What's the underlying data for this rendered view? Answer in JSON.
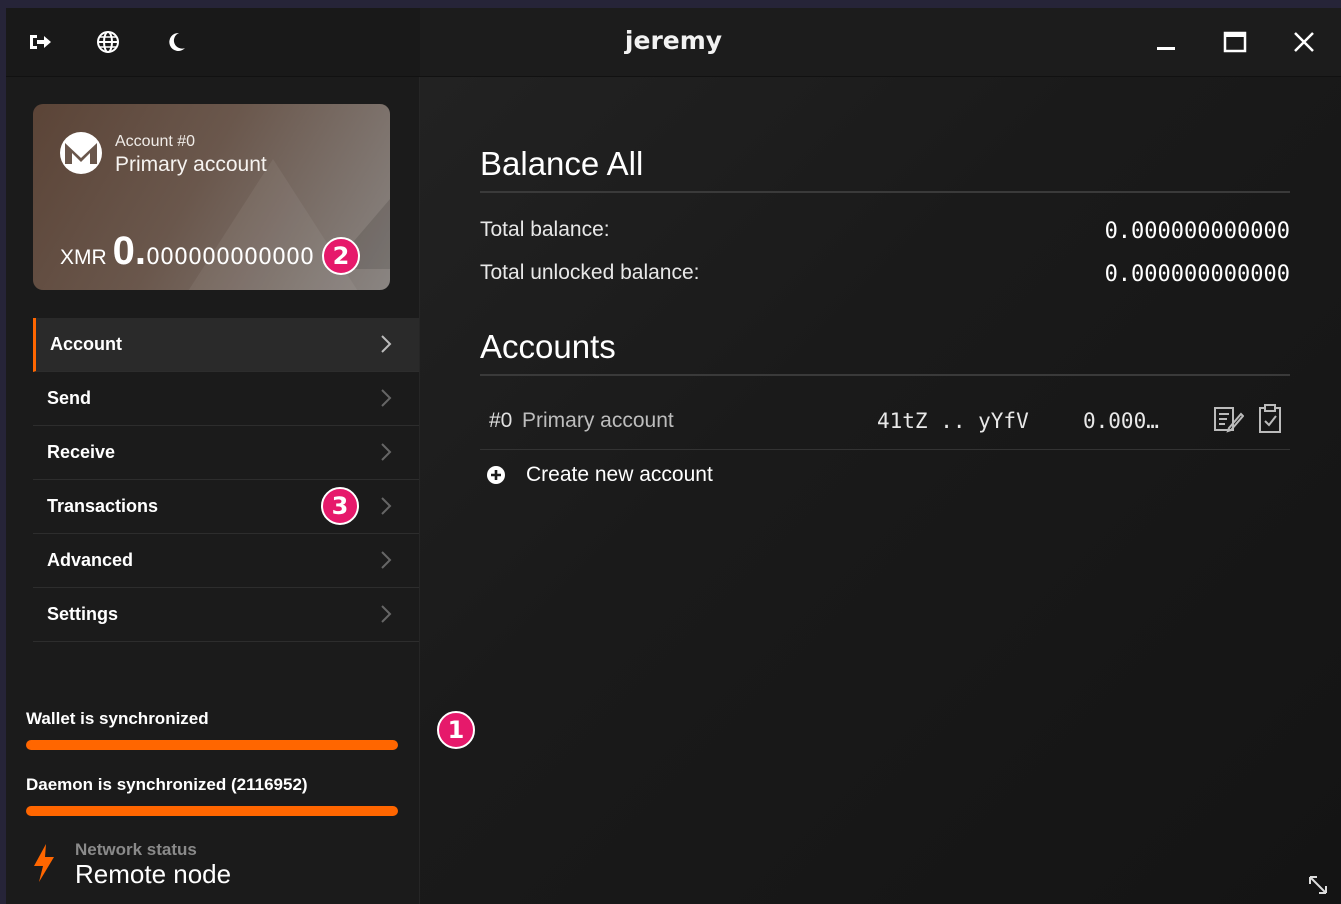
{
  "window": {
    "title": "jeremy"
  },
  "titlebar_icons": [
    "logout-icon",
    "globe-icon",
    "moon-icon",
    "minimize-icon",
    "maximize-icon",
    "close-icon"
  ],
  "card": {
    "account_number": "Account #0",
    "account_name": "Primary account",
    "currency": "XMR",
    "balance_int": "0.",
    "balance_dec": "000000000000"
  },
  "badges": {
    "one": "1",
    "two": "2",
    "three": "3"
  },
  "menu": {
    "items": [
      {
        "label": "Account"
      },
      {
        "label": "Send"
      },
      {
        "label": "Receive"
      },
      {
        "label": "Transactions"
      },
      {
        "label": "Advanced"
      },
      {
        "label": "Settings"
      }
    ]
  },
  "sync": {
    "wallet": "Wallet is synchronized",
    "daemon": "Daemon is synchronized (2116952)",
    "wallet_progress": 1.0,
    "daemon_progress": 1.0
  },
  "network": {
    "label": "Network status",
    "value": "Remote node"
  },
  "balance": {
    "heading": "Balance All",
    "total_label": "Total balance:",
    "total_value": "0.000000000000",
    "unlocked_label": "Total unlocked balance:",
    "unlocked_value": "0.000000000000"
  },
  "accounts": {
    "heading": "Accounts",
    "rows": [
      {
        "index": "#0",
        "name": "Primary account",
        "address": "41tZ .. yYfV",
        "balance": "0.000…"
      }
    ],
    "create_label": "Create new account"
  },
  "colors": {
    "accent": "#ff6600",
    "badge": "#e6196b"
  }
}
